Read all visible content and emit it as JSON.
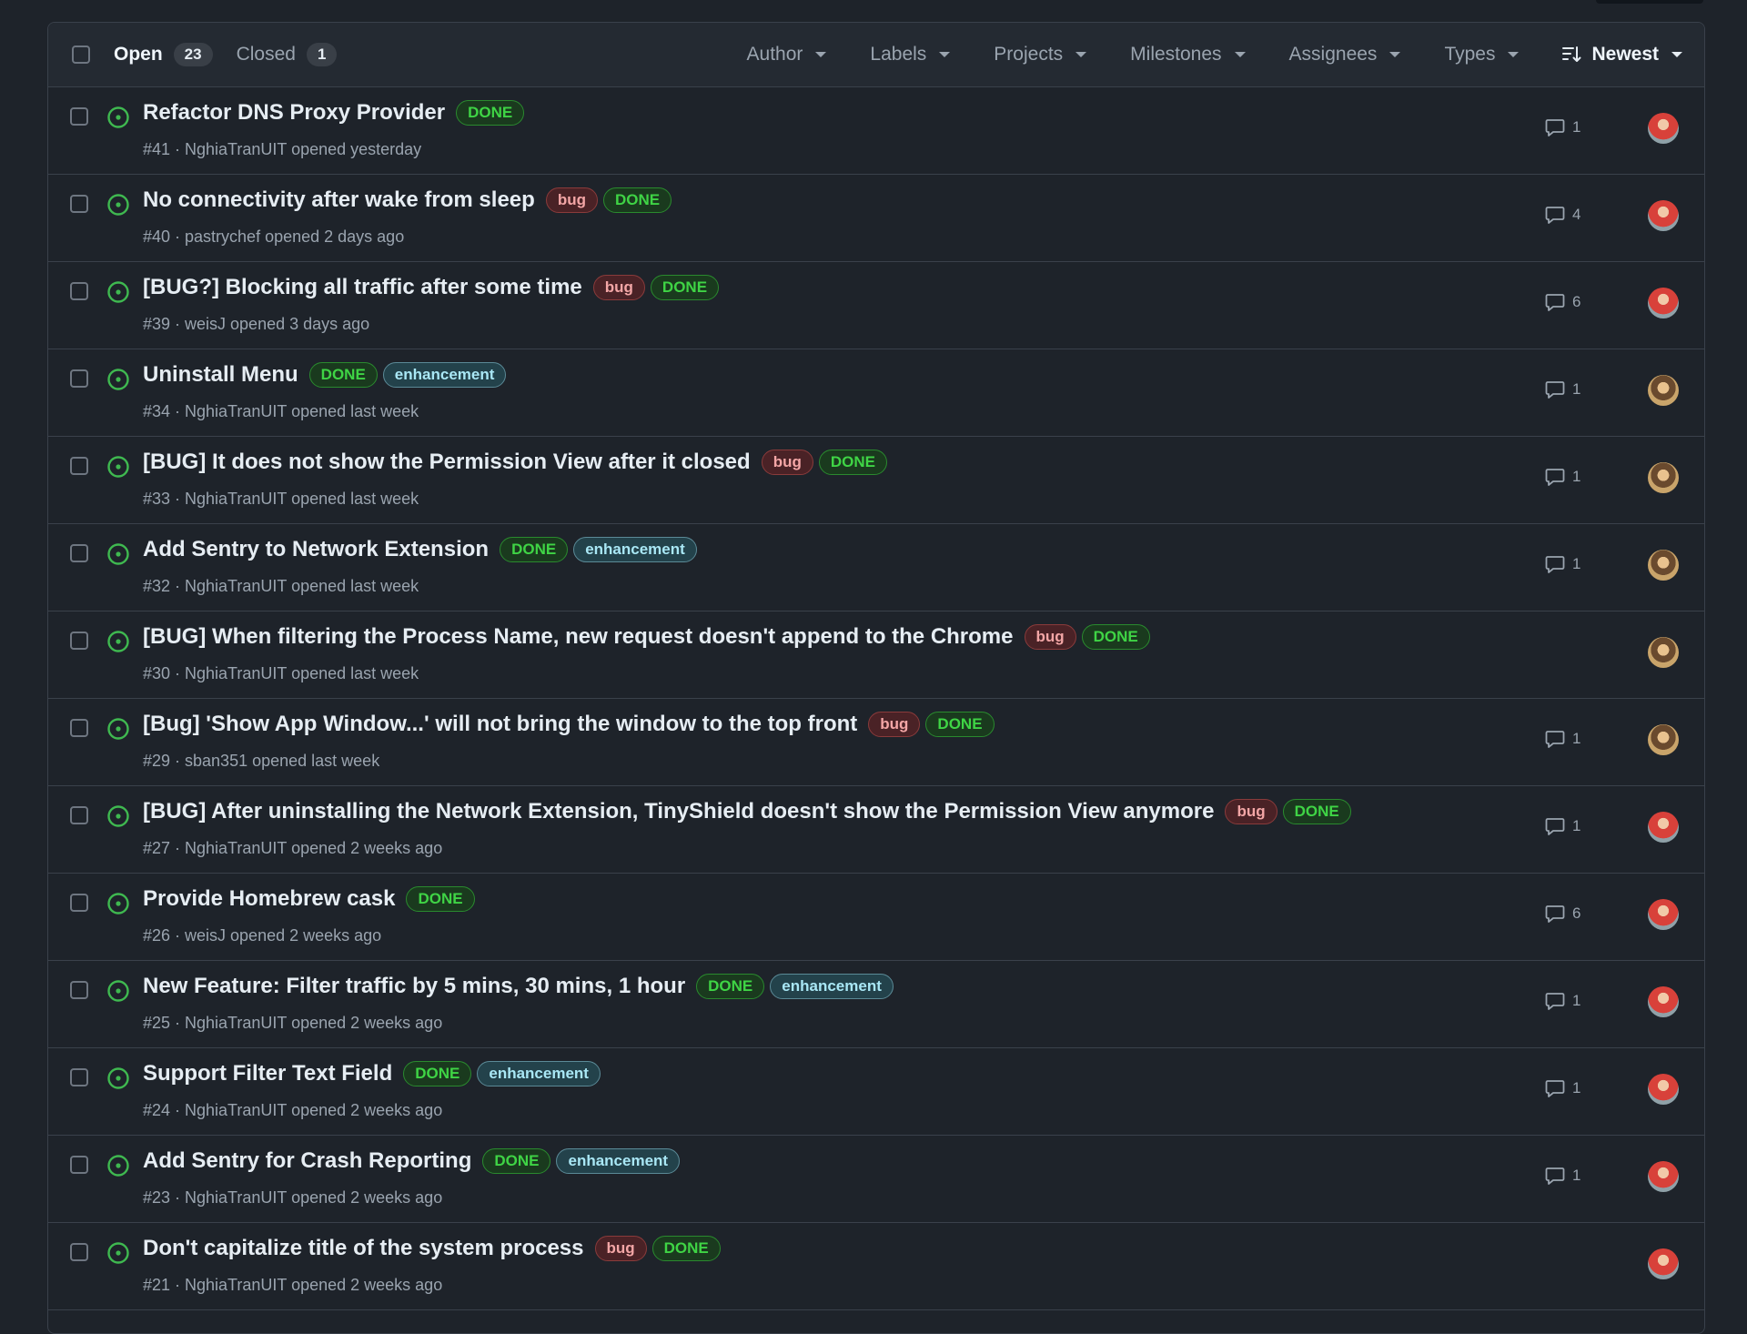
{
  "header": {
    "open_label": "Open",
    "open_count": "23",
    "closed_label": "Closed",
    "closed_count": "1",
    "filters": [
      "Author",
      "Labels",
      "Projects",
      "Milestones",
      "Assignees",
      "Types"
    ],
    "sort_label": "Newest"
  },
  "colors": {
    "done_label": "#3fd445",
    "bug_label": "#f3a6a6",
    "enhancement_label": "#a9e7f5",
    "open_status_icon": "#3fb950"
  },
  "issues": [
    {
      "title": "Refactor DNS Proxy Provider",
      "labels": [
        "DONE"
      ],
      "meta": "#41 · NghiaTranUIT opened yesterday",
      "comments": "1",
      "avatar": "a"
    },
    {
      "title": "No connectivity after wake from sleep",
      "labels": [
        "bug",
        "DONE"
      ],
      "meta": "#40 · pastrychef opened 2 days ago",
      "comments": "4",
      "avatar": "a"
    },
    {
      "title": "[BUG?] Blocking all traffic after some time",
      "labels": [
        "bug",
        "DONE"
      ],
      "meta": "#39 · weisJ opened 3 days ago",
      "comments": "6",
      "avatar": "a"
    },
    {
      "title": "Uninstall Menu",
      "labels": [
        "DONE",
        "enhancement"
      ],
      "meta": "#34 · NghiaTranUIT opened last week",
      "comments": "1",
      "avatar": "b"
    },
    {
      "title": "[BUG] It does not show the Permission View after it closed",
      "labels": [
        "bug",
        "DONE"
      ],
      "meta": "#33 · NghiaTranUIT opened last week",
      "comments": "1",
      "avatar": "b"
    },
    {
      "title": "Add Sentry to Network Extension",
      "labels": [
        "DONE",
        "enhancement"
      ],
      "meta": "#32 · NghiaTranUIT opened last week",
      "comments": "1",
      "avatar": "b"
    },
    {
      "title": "[BUG] When filtering the Process Name, new request doesn't append to the Chrome",
      "labels": [
        "bug",
        "DONE"
      ],
      "meta": "#30 · NghiaTranUIT opened last week",
      "comments": "",
      "avatar": "b"
    },
    {
      "title": "[Bug] 'Show App Window...' will not bring the window to the top front",
      "labels": [
        "bug",
        "DONE"
      ],
      "meta": "#29 · sban351 opened last week",
      "comments": "1",
      "avatar": "b"
    },
    {
      "title": "[BUG] After uninstalling the Network Extension, TinyShield doesn't show the Permission View anymore",
      "labels": [
        "bug",
        "DONE"
      ],
      "meta": "#27 · NghiaTranUIT opened 2 weeks ago",
      "comments": "1",
      "avatar": "a"
    },
    {
      "title": "Provide Homebrew cask",
      "labels": [
        "DONE"
      ],
      "meta": "#26 · weisJ opened 2 weeks ago",
      "comments": "6",
      "avatar": "a"
    },
    {
      "title": "New Feature: Filter traffic by 5 mins, 30 mins, 1 hour",
      "labels": [
        "DONE",
        "enhancement"
      ],
      "meta": "#25 · NghiaTranUIT opened 2 weeks ago",
      "comments": "1",
      "avatar": "a"
    },
    {
      "title": "Support Filter Text Field",
      "labels": [
        "DONE",
        "enhancement"
      ],
      "meta": "#24 · NghiaTranUIT opened 2 weeks ago",
      "comments": "1",
      "avatar": "a"
    },
    {
      "title": "Add Sentry for Crash Reporting",
      "labels": [
        "DONE",
        "enhancement"
      ],
      "meta": "#23 · NghiaTranUIT opened 2 weeks ago",
      "comments": "1",
      "avatar": "a"
    },
    {
      "title": "Don't capitalize title of the system process",
      "labels": [
        "bug",
        "DONE"
      ],
      "meta": "#21 · NghiaTranUIT opened 2 weeks ago",
      "comments": "",
      "avatar": "a"
    }
  ]
}
